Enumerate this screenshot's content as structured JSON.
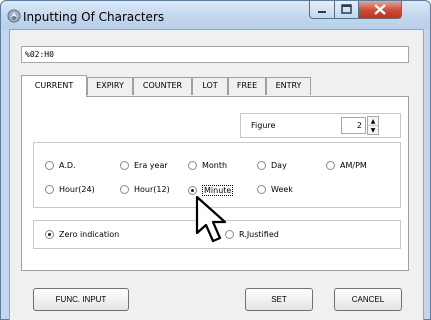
{
  "window": {
    "title": "Inputting Of Characters",
    "icon": "app-icon"
  },
  "input": {
    "value": "%02:H0"
  },
  "tabs": [
    {
      "label": "CURRENT",
      "active": true
    },
    {
      "label": "EXPIRY",
      "active": false
    },
    {
      "label": "COUNTER",
      "active": false
    },
    {
      "label": "LOT",
      "active": false
    },
    {
      "label": "FREE",
      "active": false
    },
    {
      "label": "ENTRY",
      "active": false
    }
  ],
  "figure": {
    "label": "Figure",
    "value": "2"
  },
  "date_options": [
    {
      "label": "A.D.",
      "selected": false
    },
    {
      "label": "Era year",
      "selected": false
    },
    {
      "label": "Month",
      "selected": false
    },
    {
      "label": "Day",
      "selected": false
    },
    {
      "label": "AM/PM",
      "selected": false
    },
    {
      "label": "Hour(24)",
      "selected": false
    },
    {
      "label": "Hour(12)",
      "selected": false
    },
    {
      "label": "Minute",
      "selected": true
    },
    {
      "label": "Week",
      "selected": false
    }
  ],
  "justify_options": [
    {
      "label": "Zero indication",
      "selected": true
    },
    {
      "label": "R.Justified",
      "selected": false
    }
  ],
  "buttons": {
    "func_input": "FUNC. INPUT",
    "set": "SET",
    "cancel": "CANCEL"
  },
  "colors": {
    "title_bar": "#c1d6ec",
    "close_button": "#cc4b34",
    "dialog_bg": "#f0f0f0"
  }
}
